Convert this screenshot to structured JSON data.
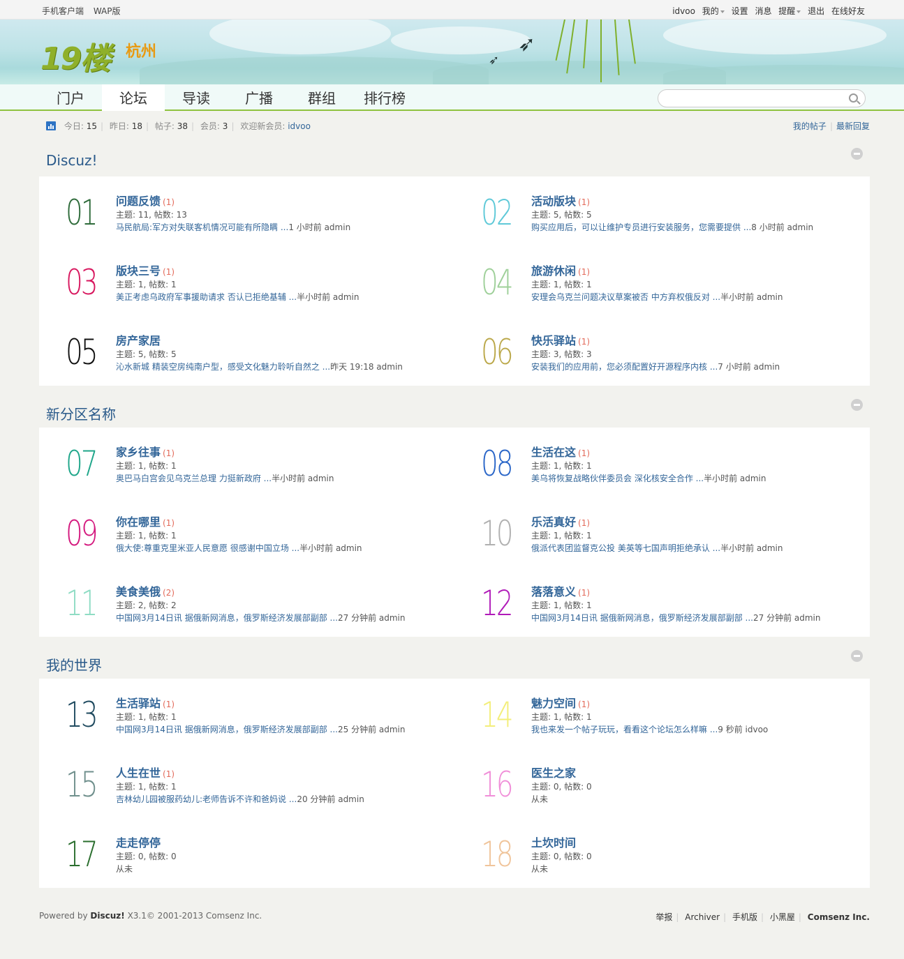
{
  "topbar": {
    "left": [
      "手机客户端",
      "WAP版"
    ],
    "user": "idvoo",
    "my": "我的",
    "settings": "设置",
    "messages": "消息",
    "reminders": "提醒",
    "logout": "退出",
    "friends": "在线好友"
  },
  "brand": {
    "logo": "19楼",
    "city": "杭州"
  },
  "nav": {
    "items": [
      "门户",
      "论坛",
      "导读",
      "广播",
      "群组",
      "排行榜"
    ],
    "active": "论坛",
    "search_placeholder": ""
  },
  "stats": {
    "today_label": "今日:",
    "today": "15",
    "yesterday_label": "昨日:",
    "yesterday": "18",
    "posts_label": "帖子:",
    "posts": "38",
    "members_label": "会员:",
    "members": "3",
    "newmember_label": "欢迎新会员:",
    "newmember": "idvoo",
    "my_posts": "我的帖子",
    "latest_replies": "最新回复"
  },
  "sections": [
    {
      "title": "Discuz!",
      "forums": [
        {
          "num": "01",
          "color": "#2e6b3a",
          "name": "问题反馈",
          "new": "(1)",
          "meta": "主题: 11, 帖数: 13",
          "last_title": "马民航局:军方对失联客机情况可能有所隐瞒 ...",
          "last_time": "1 小时前 admin"
        },
        {
          "num": "02",
          "color": "#5fc9d8",
          "name": "活动版块",
          "new": "(1)",
          "meta": "主题: 5, 帖数: 5",
          "last_title": "购买应用后，可以让维护专员进行安装服务，您需要提供 ...",
          "last_time": "8 小时前 admin"
        },
        {
          "num": "03",
          "color": "#d8185f",
          "name": "版块三号",
          "new": "(1)",
          "meta": "主题: 1, 帖数: 1",
          "last_title": "美正考虑乌政府军事援助请求 否认已拒绝基辅 ...",
          "last_time": "半小时前 admin"
        },
        {
          "num": "04",
          "color": "#9fd09a",
          "name": "旅游休闲",
          "new": "(1)",
          "meta": "主题: 1, 帖数: 1",
          "last_title": "安理会乌克兰问题决议草案被否 中方弃权俄反对 ...",
          "last_time": "半小时前 admin"
        },
        {
          "num": "05",
          "color": "#111111",
          "name": "房产家居",
          "new": "",
          "meta": "主题: 5, 帖数: 5",
          "last_title": "沁水新城 精装空房纯南户型，感受文化魅力聆听自然之 ...",
          "last_time": "昨天 19:18 admin"
        },
        {
          "num": "06",
          "color": "#bba84a",
          "name": "快乐驿站",
          "new": "(1)",
          "meta": "主题: 3, 帖数: 3",
          "last_title": "安装我们的应用前，您必须配置好开源程序内核 ...",
          "last_time": "7 小时前 admin"
        }
      ]
    },
    {
      "title": "新分区名称",
      "forums": [
        {
          "num": "07",
          "color": "#1fa68a",
          "name": "家乡往事",
          "new": "(1)",
          "meta": "主题: 1, 帖数: 1",
          "last_title": "奥巴马白宫会见乌克兰总理 力挺新政府 ...",
          "last_time": "半小时前 admin"
        },
        {
          "num": "08",
          "color": "#2a66c8",
          "name": "生活在这",
          "new": "(1)",
          "meta": "主题: 1, 帖数: 1",
          "last_title": "美乌将恢复战略伙伴委员会 深化核安全合作 ...",
          "last_time": "半小时前 admin"
        },
        {
          "num": "09",
          "color": "#d4197e",
          "name": "你在哪里",
          "new": "(1)",
          "meta": "主题: 1, 帖数: 1",
          "last_title": "俄大使:尊重克里米亚人民意愿 很感谢中国立场 ...",
          "last_time": "半小时前 admin"
        },
        {
          "num": "10",
          "color": "#b0b0b0",
          "name": "乐活真好",
          "new": "(1)",
          "meta": "主题: 1, 帖数: 1",
          "last_title": "俄派代表团监督克公投 美英等七国声明拒绝承认 ...",
          "last_time": "半小时前 admin"
        },
        {
          "num": "11",
          "color": "#8fdcc4",
          "name": "美食美俄",
          "new": "(2)",
          "meta": "主题: 2, 帖数: 2",
          "last_title": "中国网3月14日讯 据俄新网消息，俄罗斯经济发展部副部 ...",
          "last_time": "27 分钟前 admin"
        },
        {
          "num": "12",
          "color": "#b01ab8",
          "name": "落落意义",
          "new": "(1)",
          "meta": "主题: 1, 帖数: 1",
          "last_title": "中国网3月14日讯 据俄新网消息，俄罗斯经济发展部副部 ...",
          "last_time": "27 分钟前 admin"
        }
      ]
    },
    {
      "title": "我的世界",
      "forums": [
        {
          "num": "13",
          "color": "#1f4a5f",
          "name": "生活驿站",
          "new": "(1)",
          "meta": "主题: 1, 帖数: 1",
          "last_title": "中国网3月14日讯 据俄新网消息，俄罗斯经济发展部副部 ...",
          "last_time": "25 分钟前 admin"
        },
        {
          "num": "14",
          "color": "#f3ee7a",
          "name": "魅力空间",
          "new": "(1)",
          "meta": "主题: 1, 帖数: 1",
          "last_title": "我也来发一个帖子玩玩，看看这个论坛怎么样嘛 ...",
          "last_time": "9 秒前 idvoo"
        },
        {
          "num": "15",
          "color": "#6f8f8c",
          "name": "人生在世",
          "new": "(1)",
          "meta": "主题: 1, 帖数: 1",
          "last_title": "吉林幼儿园被服药幼儿:老师告诉不许和爸妈说 ...",
          "last_time": "20 分钟前 admin"
        },
        {
          "num": "16",
          "color": "#f08ed8",
          "name": "医生之家",
          "new": "",
          "meta": "主题: 0, 帖数: 0",
          "last_title": "",
          "last_time": "从未"
        },
        {
          "num": "17",
          "color": "#2a6e2e",
          "name": "走走停停",
          "new": "",
          "meta": "主题: 0, 帖数: 0",
          "last_title": "",
          "last_time": "从未"
        },
        {
          "num": "18",
          "color": "#f0c49a",
          "name": "土坎时间",
          "new": "",
          "meta": "主题: 0, 帖数: 0",
          "last_title": "",
          "last_time": "从未"
        }
      ]
    }
  ],
  "footer": {
    "powered_prefix": "Powered by",
    "powered_brand": "Discuz!",
    "powered_suffix": "X3.1© 2001-2013 Comsenz Inc.",
    "links": [
      "举报",
      "Archiver",
      "手机版",
      "小黑屋"
    ],
    "company": "Comsenz Inc."
  }
}
